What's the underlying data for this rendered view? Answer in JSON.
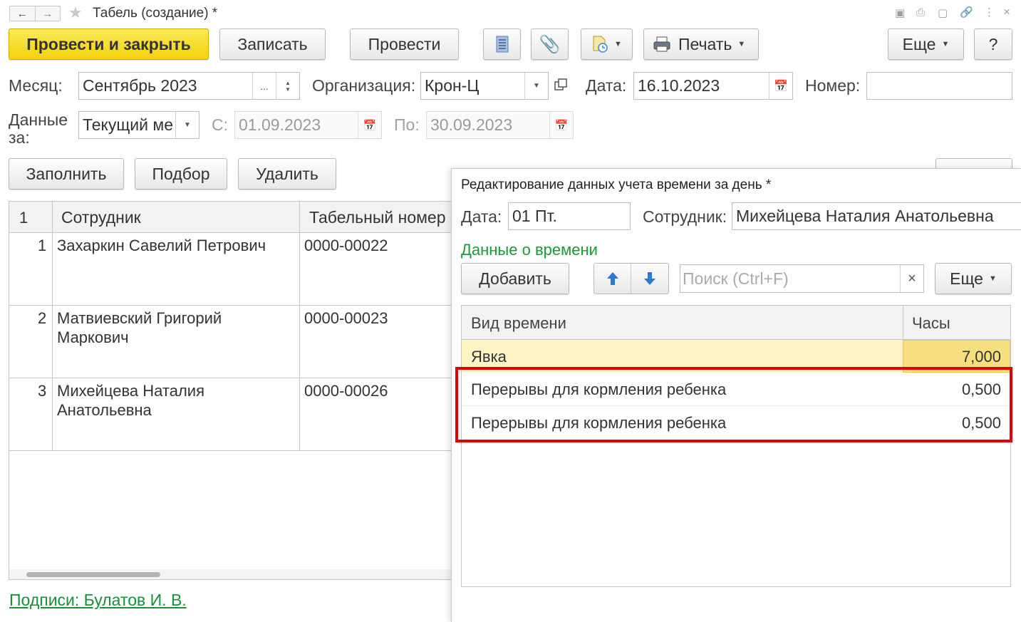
{
  "window": {
    "title": "Табель (создание) *"
  },
  "toolbar": {
    "post_close": "Провести и закрыть",
    "write": "Записать",
    "post": "Провести",
    "print": "Печать",
    "more": "Еще",
    "help": "?"
  },
  "header": {
    "month_label": "Месяц:",
    "month_value": "Сентябрь 2023",
    "month_ellipsis": "...",
    "org_label": "Организация:",
    "org_value": "Крон-Ц",
    "date_label": "Дата:",
    "date_value": "16.10.2023",
    "number_label": "Номер:",
    "number_value": "",
    "data_for_label": "Данные за:",
    "data_for_value": "Текущий ме",
    "from_label": "С:",
    "from_value": "01.09.2023",
    "to_label": "По:",
    "to_value": "30.09.2023"
  },
  "table_toolbar": {
    "fill": "Заполнить",
    "select": "Подбор",
    "delete": "Удалить"
  },
  "table": {
    "columns": [
      "1",
      "Сотрудник",
      "Табельный номер"
    ],
    "rows": [
      {
        "n": "1",
        "employee_line1": "Захаркин Савелий Петрович",
        "employee_line2": "",
        "tab_no": "0000-00022"
      },
      {
        "n": "2",
        "employee_line1": "Матвиевский Григорий",
        "employee_line2": "Маркович",
        "tab_no": "0000-00023"
      },
      {
        "n": "3",
        "employee_line1": "Михейцева Наталия",
        "employee_line2": "Анатольевна",
        "tab_no": "0000-00026"
      }
    ]
  },
  "footer": {
    "signatures_link": "Подписи: Булатов И. В."
  },
  "dialog": {
    "title": "Редактирование данных учета времени за день *",
    "date_label": "Дата:",
    "date_value": "01 Пт.",
    "employee_label": "Сотрудник:",
    "employee_value": "Михейцева Наталия Анатольевна",
    "section_title": "Данные о времени",
    "add_button": "Добавить",
    "search_placeholder": "Поиск (Ctrl+F)",
    "clear": "×",
    "more": "Еще",
    "columns": [
      "Вид времени",
      "Часы"
    ],
    "rows": [
      {
        "kind": "Явка",
        "hours": "7,000"
      },
      {
        "kind": "Перерывы для кормления ребенка",
        "hours": "0,500"
      },
      {
        "kind": "Перерывы для кормления ребенка",
        "hours": "0,500"
      }
    ]
  },
  "colors": {
    "primary_button": "#f2d30a",
    "link": "#1a8f3a",
    "section_title": "#1a9a3a",
    "selected_row": "#fdf4c5",
    "selected_cell": "#f7df80",
    "highlight_frame": "#e10000",
    "arrow_blue": "#2e7ad1"
  }
}
